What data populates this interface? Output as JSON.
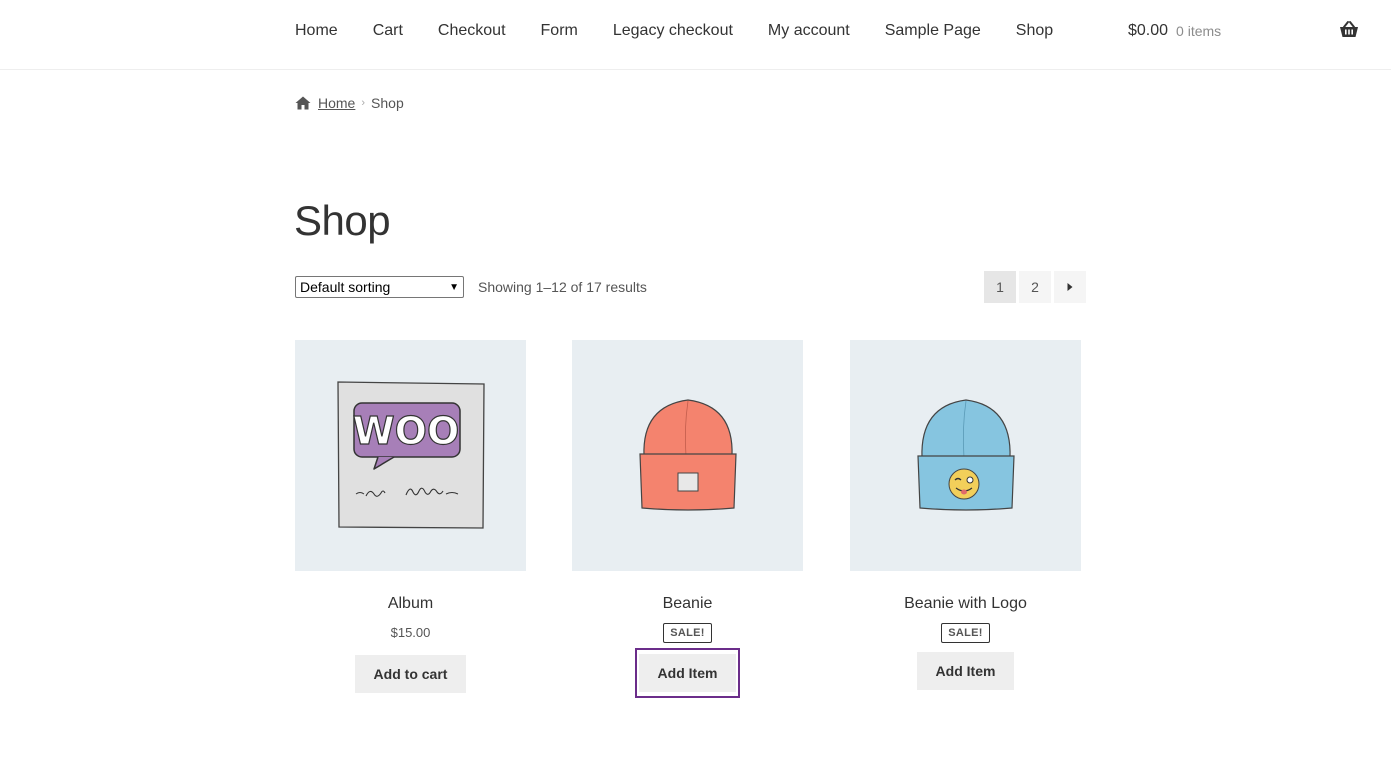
{
  "nav": [
    "Home",
    "Cart",
    "Checkout",
    "Form",
    "Legacy checkout",
    "My account",
    "Sample Page",
    "Shop"
  ],
  "cart": {
    "amount": "$0.00",
    "count": "0 items"
  },
  "breadcrumb": {
    "home": "Home",
    "current": "Shop"
  },
  "page_title": "Shop",
  "toolbar": {
    "sort_selected": "Default sorting",
    "result_count": "Showing 1–12 of 17 results",
    "pages": [
      "1",
      "2"
    ]
  },
  "products": [
    {
      "name": "Album",
      "price": "$15.00",
      "button": "Add to cart"
    },
    {
      "name": "Beanie",
      "badge": "SALE!",
      "button": "Add Item"
    },
    {
      "name": "Beanie with Logo",
      "badge": "SALE!",
      "button": "Add Item"
    }
  ],
  "colors": {
    "focus_outline": "#6b2d8a",
    "button_bg": "#eeeeee",
    "image_bg": "#e8eef2"
  }
}
